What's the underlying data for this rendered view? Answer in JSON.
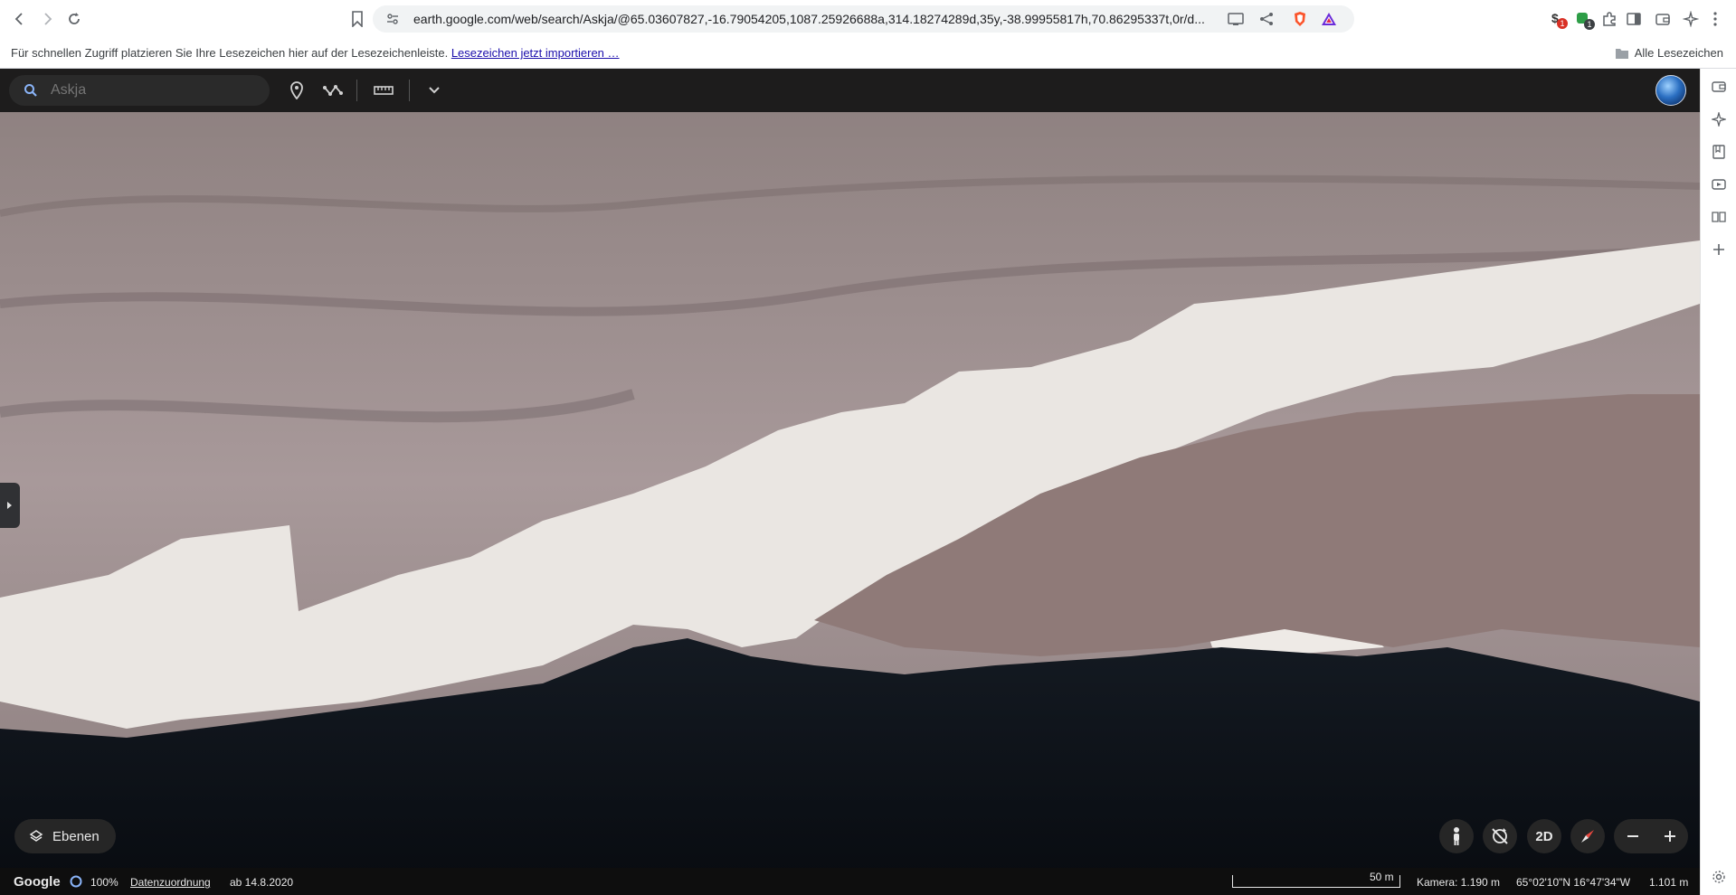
{
  "browser": {
    "url": "earth.google.com/web/search/Askja/@65.03607827,-16.79054205,1087.25926688a,314.18274289d,35y,-38.99955817h,70.86295337t,0r/d...",
    "extension_badge_1": "1",
    "extension_badge_2": "1"
  },
  "bookmarks_bar": {
    "hint": "Für schnellen Zugriff platzieren Sie Ihre Lesezeichen hier auf der Lesezeichenleiste.",
    "import_link": "Lesezeichen jetzt importieren …",
    "all_bookmarks": "Alle Lesezeichen"
  },
  "earth": {
    "search": {
      "placeholder": "Askja"
    },
    "layers_label": "Ebenen",
    "mode_2d": "2D",
    "footer": {
      "logo": "Google",
      "load_percent": "100%",
      "attribution": "Datenzuordnung",
      "imagery_date": "ab 14.8.2020",
      "scale": "50 m",
      "camera": "Kamera: 1.190 m",
      "coordinates": "65°02'10\"N 16°47'34\"W",
      "elevation": "1.101 m"
    }
  },
  "colors": {
    "earth_toolbar": "#141414",
    "snow": "#eae6e2",
    "lake": "#0e1218",
    "terrain": "#9d8d8a"
  }
}
